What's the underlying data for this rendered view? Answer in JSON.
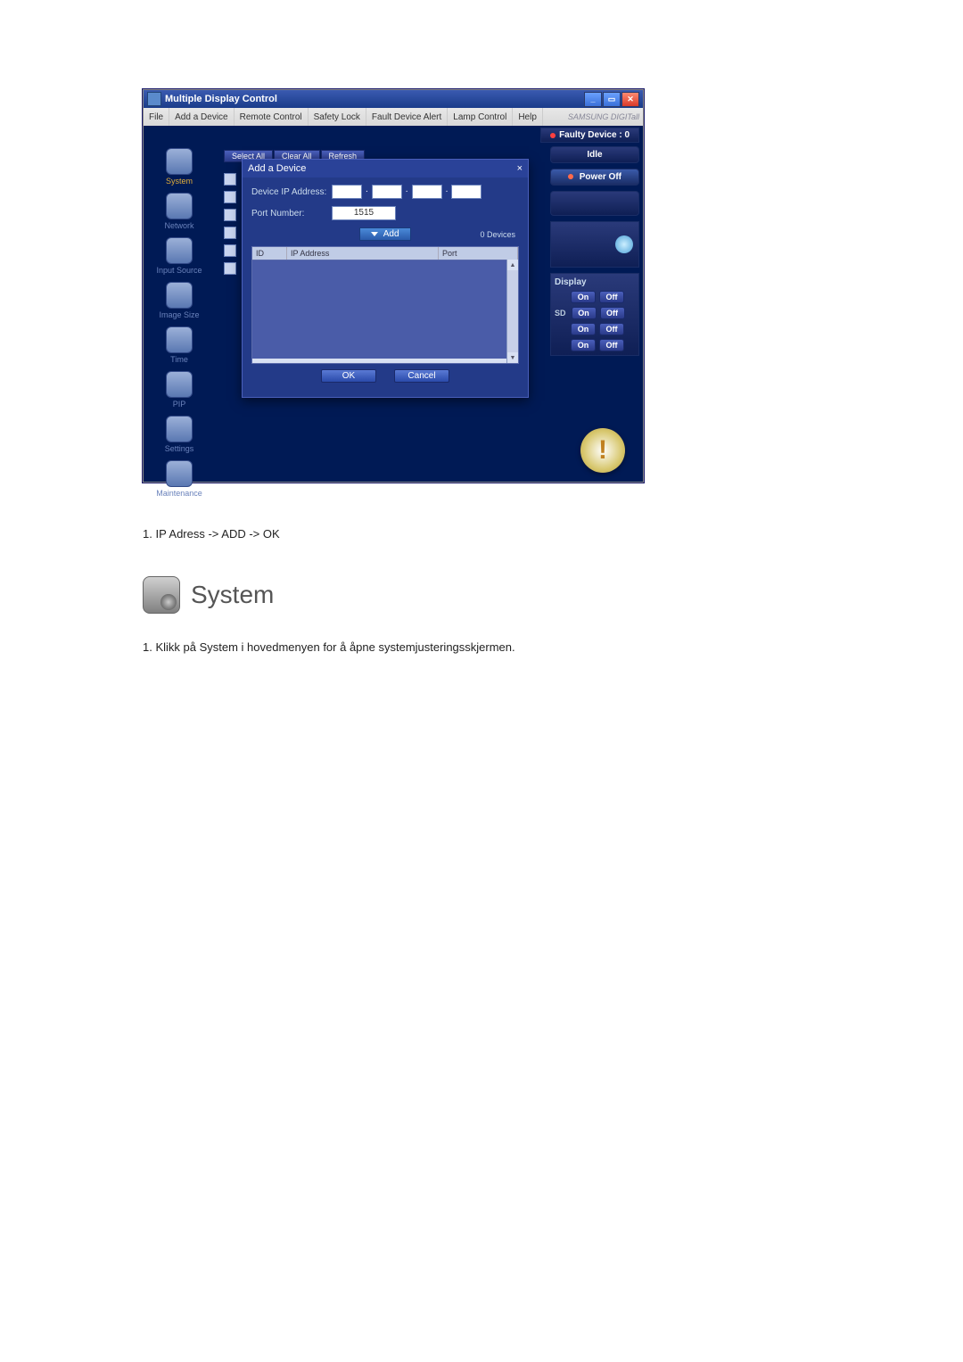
{
  "window": {
    "title": "Multiple Display Control",
    "brand": "SAMSUNG DIGITall"
  },
  "menubar": [
    "File",
    "Add a Device",
    "Remote Control",
    "Safety Lock",
    "Fault Device Alert",
    "Lamp Control",
    "Help"
  ],
  "faulty_device_label": "Faulty Device : 0",
  "top_buttons": [
    "Select All",
    "Clear All",
    "Refresh"
  ],
  "sidebar": [
    {
      "label": "System"
    },
    {
      "label": "Network"
    },
    {
      "label": "Input Source"
    },
    {
      "label": "Image Size"
    },
    {
      "label": "Time"
    },
    {
      "label": "PIP"
    },
    {
      "label": "Settings"
    },
    {
      "label": "Maintenance"
    }
  ],
  "right": {
    "idle": "Idle",
    "power_off": "Power Off",
    "display_label": "Display",
    "sd_label": "SD",
    "on": "On",
    "off": "Off"
  },
  "dialog": {
    "title": "Add a Device",
    "close": "×",
    "ip_label": "Device IP Address:",
    "port_label": "Port Number:",
    "port_value": "1515",
    "add_label": "Add",
    "device_count": "0 Devices",
    "cols": {
      "id": "ID",
      "ip": "IP Address",
      "port": "Port"
    },
    "ok": "OK",
    "cancel": "Cancel"
  },
  "caption_1": "1. IP Adress -> ADD -> OK",
  "system_heading": "System",
  "caption_2": "1. Klikk på System i hovedmenyen for å åpne systemjusteringsskjermen."
}
